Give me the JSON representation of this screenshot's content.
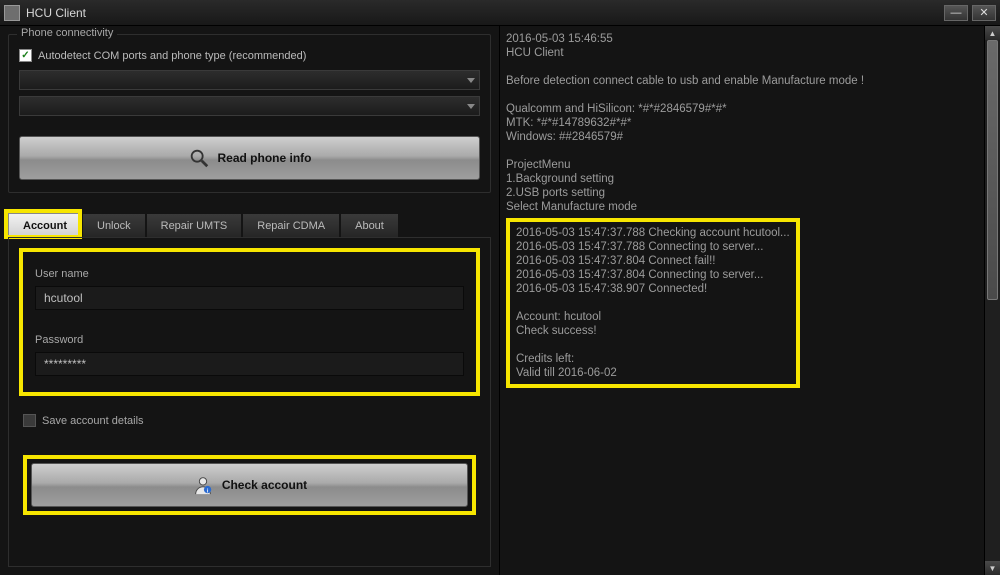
{
  "title": "HCU Client",
  "phone_connectivity": {
    "group_title": "Phone connectivity",
    "autodetect_label": "Autodetect COM ports and phone type (recommended)",
    "read_button": "Read phone info"
  },
  "tabs": {
    "account": "Account",
    "unlock": "Unlock",
    "repair_umts": "Repair UMTS",
    "repair_cdma": "Repair CDMA",
    "about": "About"
  },
  "account": {
    "username_label": "User name",
    "username_value": "hcutool",
    "password_label": "Password",
    "password_value": "*********",
    "save_label": "Save account details",
    "check_button": "Check account"
  },
  "log": {
    "pre": "2016-05-03 15:46:55\nHCU Client\n\nBefore detection connect cable to usb and enable Manufacture mode !\n\nQualcomm and HiSilicon: *#*#2846579#*#*\nMTK: *#*#14789632#*#*\nWindows: ##2846579#\n\nProjectMenu\n1.Background setting\n2.USB ports setting\nSelect Manufacture mode",
    "highlight": "2016-05-03 15:47:37.788 Checking account hcutool...\n2016-05-03 15:47:37.788 Connecting to server...\n2016-05-03 15:47:37.804 Connect fail!!\n2016-05-03 15:47:37.804 Connecting to server...\n2016-05-03 15:47:38.907 Connected!\n\nAccount: hcutool\nCheck success!\n\nCredits left:\nValid till 2016-06-02"
  }
}
